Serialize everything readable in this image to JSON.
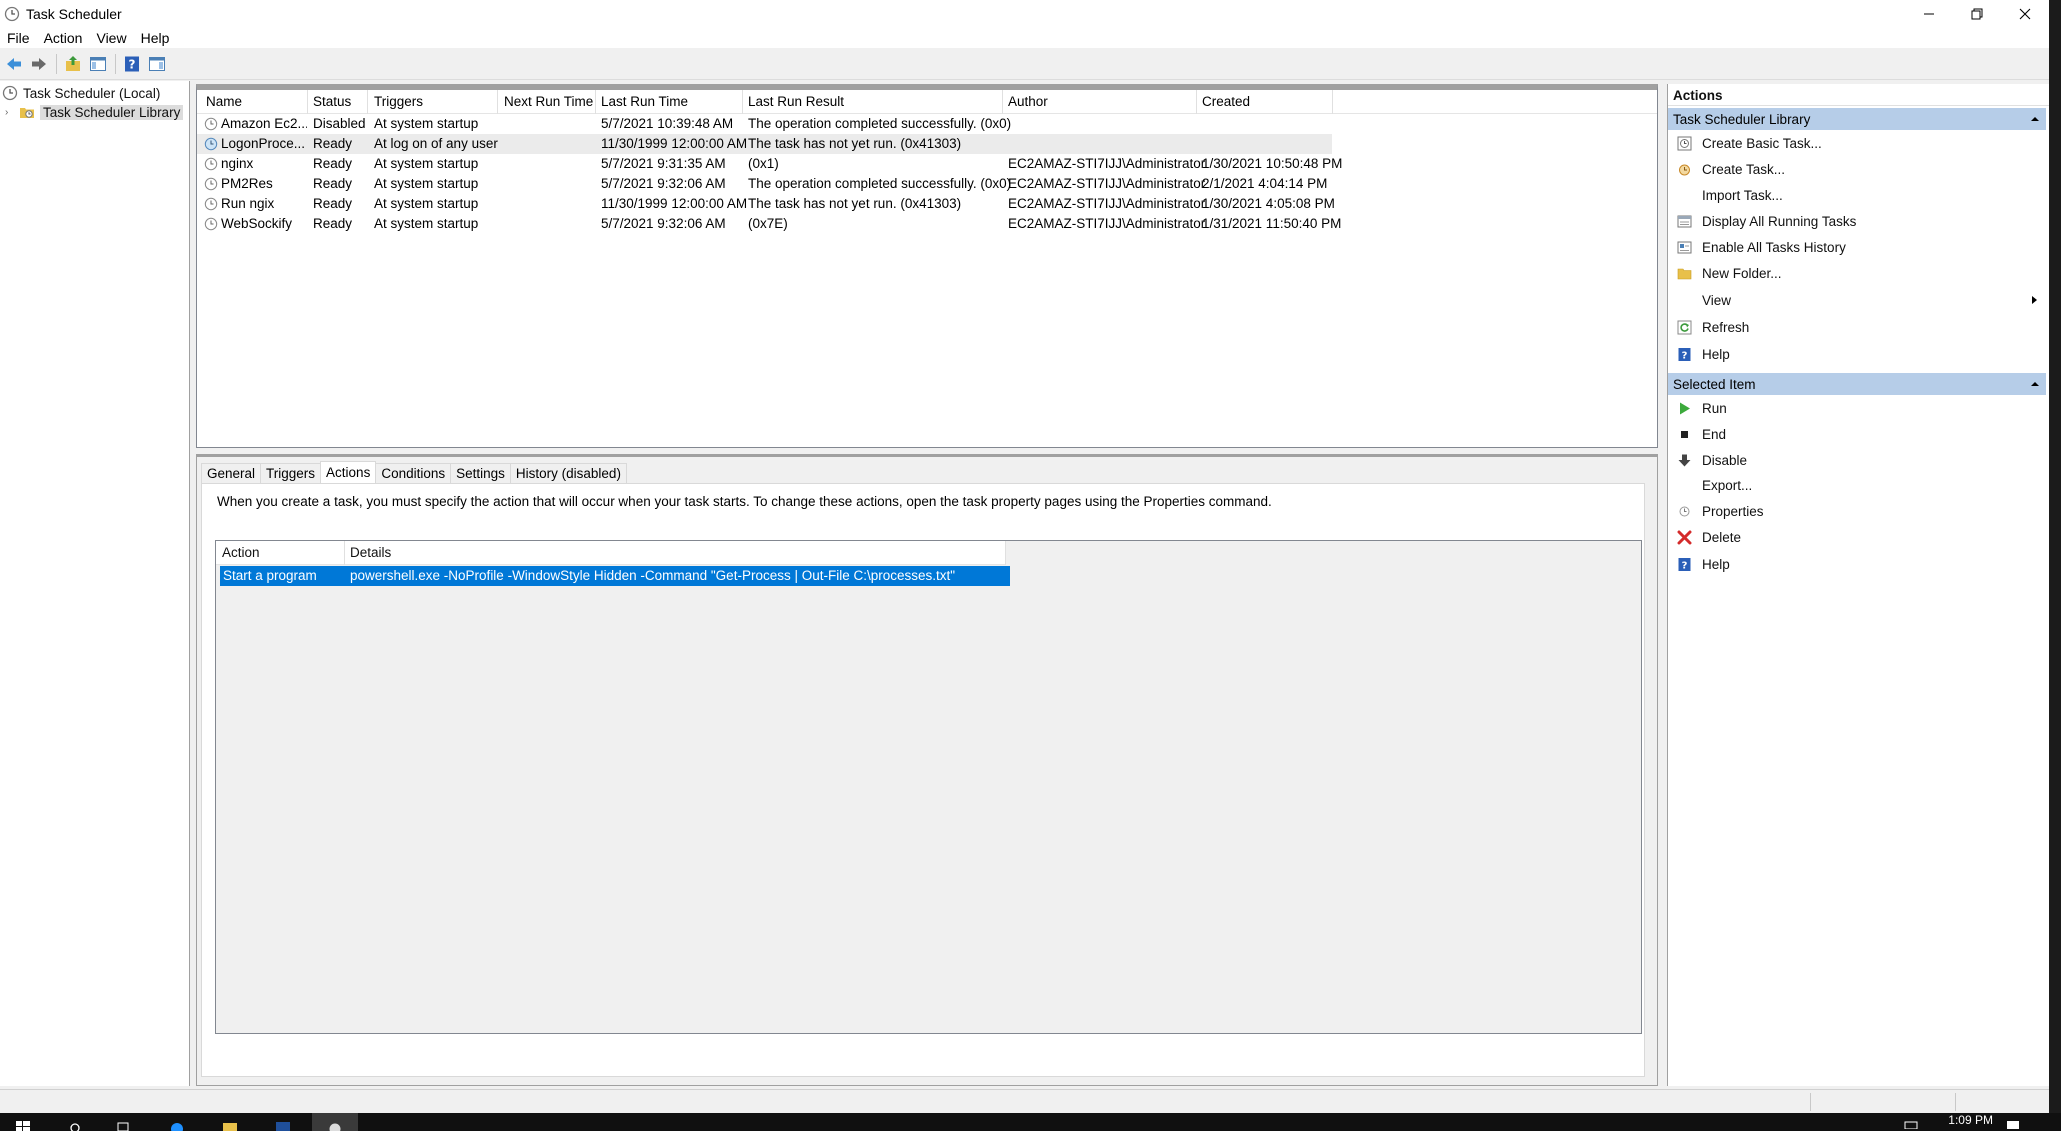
{
  "window": {
    "title": "Task Scheduler"
  },
  "menu": [
    "File",
    "Action",
    "View",
    "Help"
  ],
  "tree": {
    "root": "Task Scheduler (Local)",
    "library": "Task Scheduler Library"
  },
  "task_list": {
    "columns": [
      "Name",
      "Status",
      "Triggers",
      "Next Run Time",
      "Last Run Time",
      "Last Run Result",
      "Author",
      "Created"
    ],
    "rows": [
      {
        "name": "Amazon Ec2...",
        "status": "Disabled",
        "triggers": "At system startup",
        "next": "",
        "last": "5/7/2021 10:39:48 AM",
        "result": "The operation completed successfully. (0x0)",
        "author": "",
        "created": ""
      },
      {
        "name": "LogonProce...",
        "status": "Ready",
        "triggers": "At log on of any user",
        "next": "",
        "last": "11/30/1999 12:00:00 AM",
        "result": "The task has not yet run. (0x41303)",
        "author": "",
        "created": ""
      },
      {
        "name": "nginx",
        "status": "Ready",
        "triggers": "At system startup",
        "next": "",
        "last": "5/7/2021 9:31:35 AM",
        "result": "(0x1)",
        "author": "EC2AMAZ-STI7IJJ\\Administrator",
        "created": "1/30/2021 10:50:48 PM"
      },
      {
        "name": "PM2Res",
        "status": "Ready",
        "triggers": "At system startup",
        "next": "",
        "last": "5/7/2021 9:32:06 AM",
        "result": "The operation completed successfully. (0x0)",
        "author": "EC2AMAZ-STI7IJJ\\Administrator",
        "created": "2/1/2021 4:04:14 PM"
      },
      {
        "name": "Run ngix",
        "status": "Ready",
        "triggers": "At system startup",
        "next": "",
        "last": "11/30/1999 12:00:00 AM",
        "result": "The task has not yet run. (0x41303)",
        "author": "EC2AMAZ-STI7IJJ\\Administrator",
        "created": "1/30/2021 4:05:08 PM"
      },
      {
        "name": "WebSockify",
        "status": "Ready",
        "triggers": "At system startup",
        "next": "",
        "last": "5/7/2021 9:32:06 AM",
        "result": "(0x7E)",
        "author": "EC2AMAZ-STI7IJJ\\Administrator",
        "created": "1/31/2021 11:50:40 PM"
      }
    ]
  },
  "detail": {
    "tabs": [
      "General",
      "Triggers",
      "Actions",
      "Conditions",
      "Settings",
      "History (disabled)"
    ],
    "active_tab": "Actions",
    "description": "When you create a task, you must specify the action that will occur when your task starts.  To change these actions, open the task property pages using the Properties command.",
    "columns": [
      "Action",
      "Details"
    ],
    "row": {
      "action": "Start a program",
      "details": "powershell.exe -NoProfile -WindowStyle Hidden -Command \"Get-Process | Out-File C:\\processes.txt\""
    }
  },
  "actions_pane": {
    "title": "Actions",
    "section1": "Task Scheduler Library",
    "items1": [
      {
        "label": "Create Basic Task...",
        "icon": "create-basic-task-icon"
      },
      {
        "label": "Create Task...",
        "icon": "create-task-icon"
      },
      {
        "label": "Import Task...",
        "icon": ""
      },
      {
        "label": "Display All Running Tasks",
        "icon": "running-tasks-icon"
      },
      {
        "label": "Enable All Tasks History",
        "icon": "tasks-history-icon"
      },
      {
        "label": "New Folder...",
        "icon": "folder-icon"
      },
      {
        "label": "View",
        "icon": ""
      },
      {
        "label": "Refresh",
        "icon": "refresh-icon"
      },
      {
        "label": "Help",
        "icon": "help-icon"
      }
    ],
    "section2": "Selected Item",
    "items2": [
      {
        "label": "Run",
        "icon": "run-icon"
      },
      {
        "label": "End",
        "icon": "end-icon"
      },
      {
        "label": "Disable",
        "icon": "disable-icon"
      },
      {
        "label": "Export...",
        "icon": ""
      },
      {
        "label": "Properties",
        "icon": "properties-icon"
      },
      {
        "label": "Delete",
        "icon": "delete-icon"
      },
      {
        "label": "Help",
        "icon": "help-icon"
      }
    ]
  },
  "taskbar": {
    "clock": "1:09 PM"
  },
  "colors": {
    "selection": "#0078d7",
    "section_header": "#b6cde8",
    "window_bg": "#f0f0f0"
  }
}
